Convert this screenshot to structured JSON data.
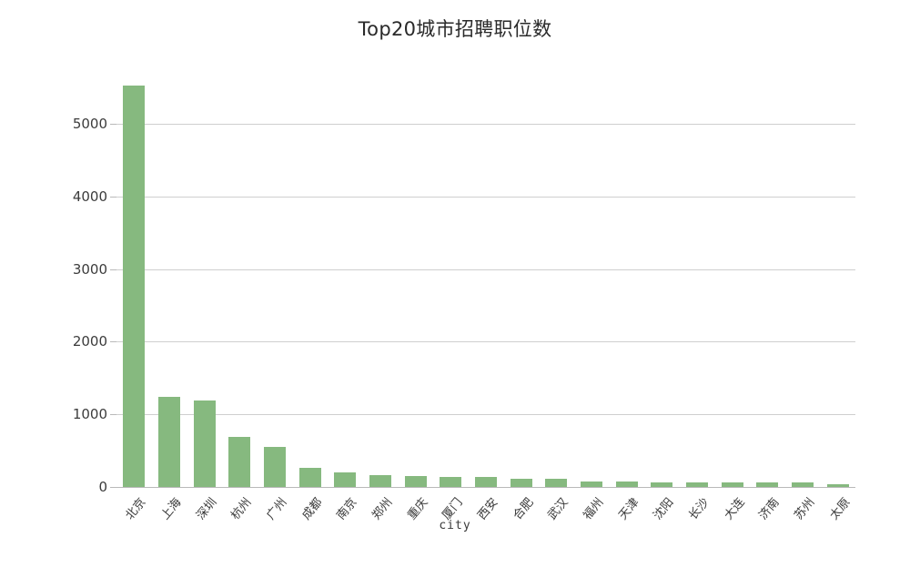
{
  "chart_data": {
    "type": "bar",
    "title": "Top20城市招聘职位数",
    "xlabel": "city",
    "ylabel": "",
    "ylim": [
      0,
      5600
    ],
    "grid": true,
    "legend": "none",
    "bar_color": "#86b97f",
    "yticks": [
      0,
      1000,
      2000,
      3000,
      4000,
      5000
    ],
    "ytick_labels": [
      "0",
      "1000",
      "2000",
      "3000",
      "4000",
      "5000"
    ],
    "categories": [
      "北京",
      "上海",
      "深圳",
      "杭州",
      "广州",
      "成都",
      "南京",
      "郑州",
      "重庆",
      "厦门",
      "西安",
      "合肥",
      "武汉",
      "福州",
      "天津",
      "沈阳",
      "长沙",
      "大连",
      "济南",
      "苏州",
      "太原"
    ],
    "values": [
      5525,
      1246,
      1188,
      684,
      546,
      265,
      198,
      169,
      156,
      139,
      135,
      113,
      113,
      76,
      72,
      68,
      60,
      62,
      60,
      58,
      40
    ],
    "series": [
      {
        "name": "招聘职位数",
        "values": [
          5525,
          1246,
          1188,
          684,
          546,
          265,
          198,
          169,
          156,
          139,
          135,
          113,
          113,
          76,
          72,
          68,
          60,
          62,
          60,
          58,
          40
        ]
      }
    ]
  }
}
